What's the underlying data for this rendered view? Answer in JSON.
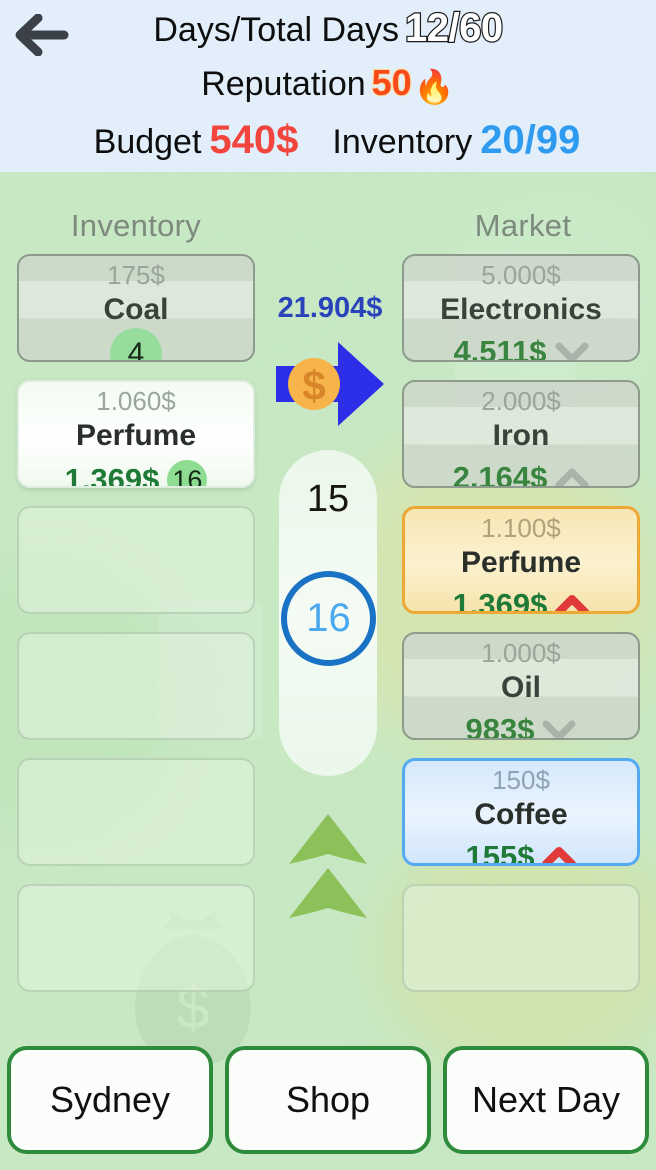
{
  "header": {
    "back_icon": "arrow-left-icon",
    "days_label": "Days/Total Days",
    "days_value": "12/60",
    "reputation_label": "Reputation",
    "reputation_value": "50",
    "reputation_icon": "flame-icon",
    "budget_label": "Budget",
    "budget_value": "540$",
    "inventory_label": "Inventory",
    "inventory_value": "20/99"
  },
  "columns": {
    "inventory_title": "Inventory",
    "market_title": "Market"
  },
  "inventory": [
    {
      "base_price": "175$",
      "name": "Coal",
      "price": "",
      "qty": "4",
      "state": "dim",
      "trend": "none"
    },
    {
      "base_price": "1.060$",
      "name": "Perfume",
      "price": "1.369$",
      "qty": "16",
      "state": "bright",
      "trend": "none"
    },
    {
      "base_price": "",
      "name": "",
      "price": "",
      "qty": "",
      "state": "empty",
      "trend": "none"
    },
    {
      "base_price": "",
      "name": "",
      "price": "",
      "qty": "",
      "state": "empty",
      "trend": "none"
    },
    {
      "base_price": "",
      "name": "",
      "price": "",
      "qty": "",
      "state": "empty",
      "trend": "none"
    },
    {
      "base_price": "",
      "name": "",
      "price": "",
      "qty": "",
      "state": "empty",
      "trend": "none"
    }
  ],
  "market": [
    {
      "base_price": "5.000$",
      "name": "Electronics",
      "price": "4.511$",
      "state": "dim",
      "trend": "down"
    },
    {
      "base_price": "2.000$",
      "name": "Iron",
      "price": "2.164$",
      "state": "dim",
      "trend": "up-grey"
    },
    {
      "base_price": "1.100$",
      "name": "Perfume",
      "price": "1.369$",
      "state": "amber",
      "trend": "up-red"
    },
    {
      "base_price": "1.000$",
      "name": "Oil",
      "price": "983$",
      "state": "dim",
      "trend": "down"
    },
    {
      "base_price": "150$",
      "name": "Coffee",
      "price": "155$",
      "state": "blue",
      "trend": "up-red"
    },
    {
      "base_price": "",
      "name": "",
      "price": "",
      "state": "empty",
      "trend": "none"
    }
  ],
  "transfer": {
    "total_value": "21.904$",
    "arrow_icon": "arrow-right-coin-icon",
    "qty_previous": "15",
    "qty_current": "16",
    "increase_icon": "double-chevron-up-icon"
  },
  "buttons": {
    "city": "Sydney",
    "shop": "Shop",
    "next_day": "Next Day"
  },
  "colors": {
    "background": "#c8e8c4",
    "header_bg": "#e2effb",
    "budget": "#f1453d",
    "inventory": "#2e9bf0",
    "reputation": "#f94a1b",
    "price_green": "#1e7a36",
    "total_blue": "#2a43ba",
    "select_blue": "#1a72c4",
    "amber_border": "#eda934",
    "blue_border": "#53aaf2",
    "btn_border": "#2f8b3c",
    "trend_up": "#e03a3a",
    "trend_grey": "#a9b3a9",
    "badge_green": "#8ddc92"
  }
}
